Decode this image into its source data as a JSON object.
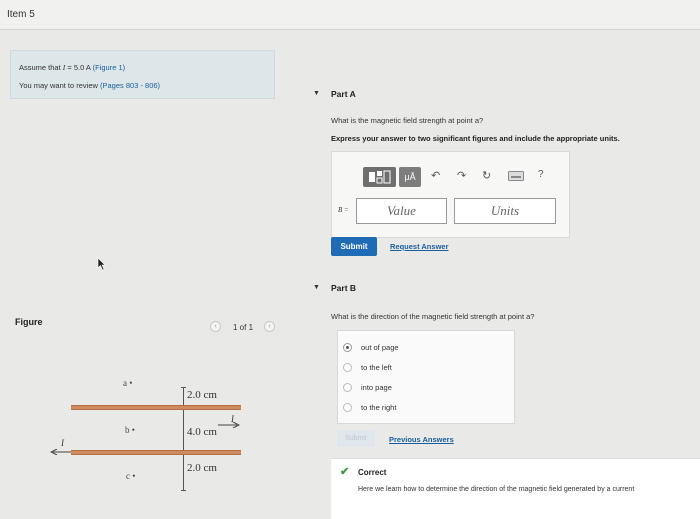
{
  "header": {
    "title": "Item 5"
  },
  "intro": {
    "line1_prefix": "Assume that ",
    "line1_var": "I",
    "line1_value": " = 5.0 A",
    "line1_link": "(Figure 1)",
    "line2_prefix": "You may want to review ",
    "line2_link": "(Pages 803 - 806)"
  },
  "part_a": {
    "title": "Part A",
    "question": "What is the magnetic field strength at point a?",
    "instruction": "Express your answer to two significant figures and include the appropriate units.",
    "toolbar": {
      "units_label": "μÅ",
      "help_label": "?"
    },
    "var_label": "B =",
    "value_placeholder": "Value",
    "units_placeholder": "Units",
    "submit_label": "Submit",
    "request_label": "Request Answer"
  },
  "part_b": {
    "title": "Part B",
    "question": "What is the direction of the magnetic field strength at point a?",
    "options": [
      "out of page",
      "to the left",
      "into page",
      "to the right"
    ],
    "selected": "out of page",
    "submit_label": "Submit",
    "previous_label": "Previous Answers",
    "correct_label": "Correct",
    "correct_text": "Here we learn how to determine the direction of the magnetic field generated by a current"
  },
  "figure": {
    "label": "Figure",
    "pager": "1 of 1",
    "points": [
      "a",
      "b",
      "c"
    ],
    "distances": [
      "2.0 cm",
      "4.0 cm",
      "2.0 cm"
    ],
    "current_label": "I"
  },
  "colors": {
    "accent": "#1f6bb5",
    "wire": "#d08a5f",
    "correct": "#3a9a3a"
  }
}
